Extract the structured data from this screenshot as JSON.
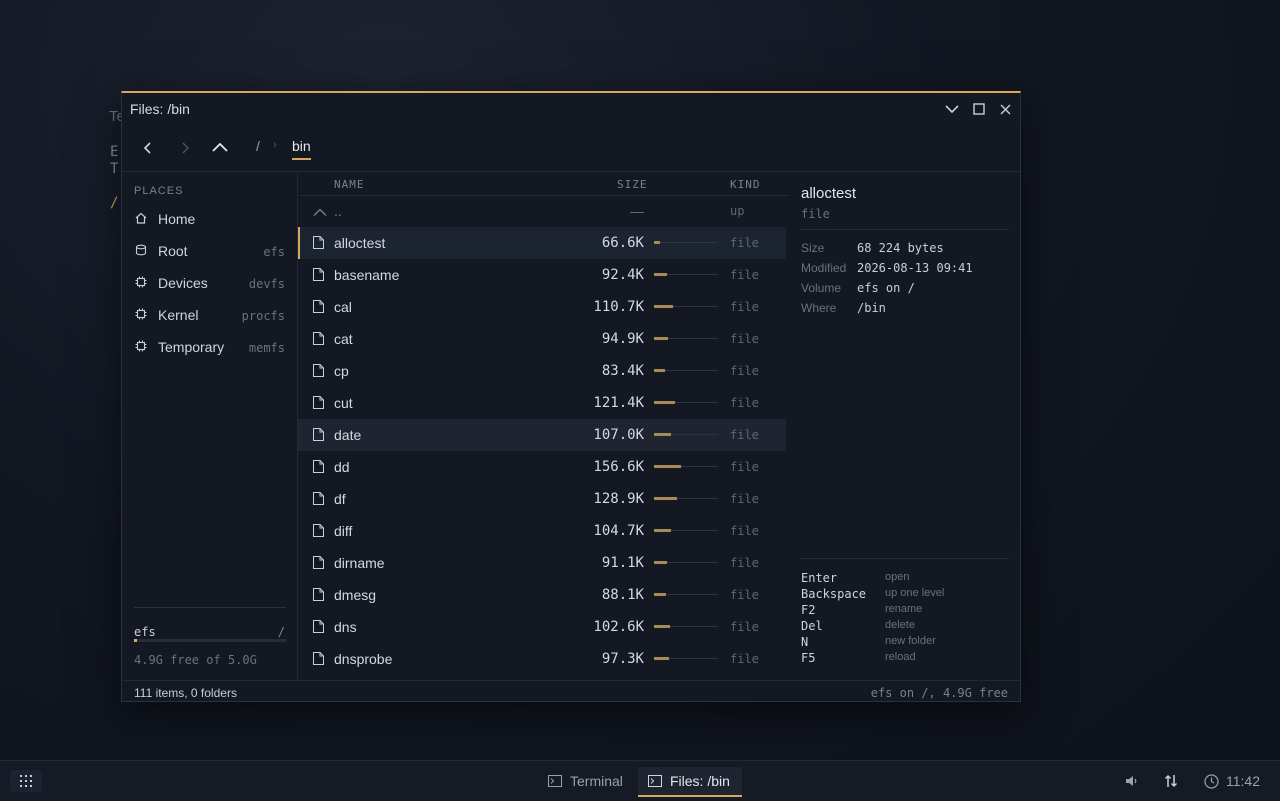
{
  "background_terminal": {
    "title_fragment": "Te",
    "lines": [
      "E",
      "T"
    ],
    "prompt": "/"
  },
  "window": {
    "title": "Files: /bin",
    "accent": "#d8a85a"
  },
  "toolbar": {
    "back_icon": "chevron-left-icon",
    "forward_icon": "chevron-right-icon",
    "up_icon": "chevron-up-icon",
    "breadcrumb": [
      "/",
      "bin"
    ]
  },
  "sidebar": {
    "header": "PLACES",
    "places": [
      {
        "label": "Home",
        "fs": "",
        "icon": "home-icon"
      },
      {
        "label": "Root",
        "fs": "efs",
        "icon": "disk-icon"
      },
      {
        "label": "Devices",
        "fs": "devfs",
        "icon": "chip-icon"
      },
      {
        "label": "Kernel",
        "fs": "procfs",
        "icon": "chip-icon"
      },
      {
        "label": "Temporary",
        "fs": "memfs",
        "icon": "chip-icon"
      }
    ],
    "volume": {
      "name": "efs",
      "mount": "/",
      "used_fraction": 0.02,
      "free_text": "4.9G free of 5.0G"
    }
  },
  "list": {
    "headers": {
      "name": "NAME",
      "size": "SIZE",
      "kind": "KIND"
    },
    "parent": {
      "name": "..",
      "size": "—",
      "kind": "up"
    },
    "rows": [
      {
        "name": "alloctest",
        "size": "66.6K",
        "fill": 0.1,
        "kind": "file"
      },
      {
        "name": "basename",
        "size": "92.4K",
        "fill": 0.21,
        "kind": "file"
      },
      {
        "name": "cal",
        "size": "110.7K",
        "fill": 0.29,
        "kind": "file"
      },
      {
        "name": "cat",
        "size": "94.9K",
        "fill": 0.22,
        "kind": "file"
      },
      {
        "name": "cp",
        "size": "83.4K",
        "fill": 0.17,
        "kind": "file"
      },
      {
        "name": "cut",
        "size": "121.4K",
        "fill": 0.33,
        "kind": "file"
      },
      {
        "name": "date",
        "size": "107.0K",
        "fill": 0.27,
        "kind": "file"
      },
      {
        "name": "dd",
        "size": "156.6K",
        "fill": 0.42,
        "kind": "file"
      },
      {
        "name": "df",
        "size": "128.9K",
        "fill": 0.36,
        "kind": "file"
      },
      {
        "name": "diff",
        "size": "104.7K",
        "fill": 0.26,
        "kind": "file"
      },
      {
        "name": "dirname",
        "size": "91.1K",
        "fill": 0.21,
        "kind": "file"
      },
      {
        "name": "dmesg",
        "size": "88.1K",
        "fill": 0.19,
        "kind": "file"
      },
      {
        "name": "dns",
        "size": "102.6K",
        "fill": 0.25,
        "kind": "file"
      },
      {
        "name": "dnsprobe",
        "size": "97.3K",
        "fill": 0.23,
        "kind": "file"
      }
    ],
    "selected": "alloctest",
    "hovered": "date"
  },
  "detail": {
    "name": "alloctest",
    "kind": "file",
    "props": [
      {
        "key": "Size",
        "value": "68 224 bytes"
      },
      {
        "key": "Modified",
        "value": "2026-08-13 09:41"
      },
      {
        "key": "Volume",
        "value": "efs on /"
      },
      {
        "key": "Where",
        "value": "/bin"
      }
    ],
    "shortcuts": [
      {
        "key": "Enter",
        "action": "open"
      },
      {
        "key": "Backspace",
        "action": "up one level"
      },
      {
        "key": "F2",
        "action": "rename"
      },
      {
        "key": "Del",
        "action": "delete"
      },
      {
        "key": "N",
        "action": "new folder"
      },
      {
        "key": "F5",
        "action": "reload"
      }
    ]
  },
  "status": {
    "left": "111 items, 0 folders",
    "right": "efs on /, 4.9G free"
  },
  "taskbar": {
    "launcher_icon": "grid-icon",
    "tasks": [
      {
        "label": "Terminal",
        "active": false
      },
      {
        "label": "Files: /bin",
        "active": true
      }
    ],
    "tray": [
      "speaker-icon",
      "network-icon",
      "clock-icon"
    ],
    "clock": "11:42"
  }
}
